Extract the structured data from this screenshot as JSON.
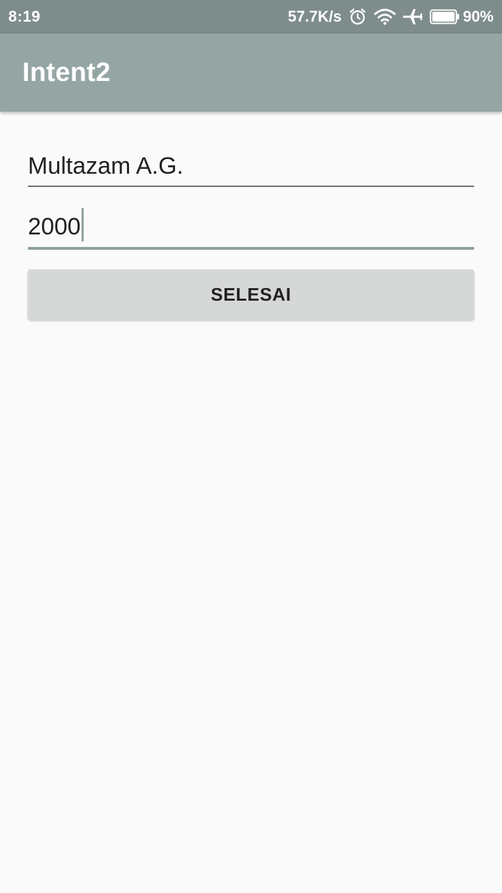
{
  "status_bar": {
    "time": "8:19",
    "network_speed": "57.7K/s",
    "battery_percent": "90%",
    "battery_level": 0.9,
    "icons": [
      "alarm-icon",
      "wifi-icon",
      "airplane-icon",
      "battery-icon"
    ]
  },
  "app_bar": {
    "title": "Intent2"
  },
  "form": {
    "name_value": "Multazam A.G.",
    "number_value": "2000",
    "submit_label": "SELESAI"
  },
  "colors": {
    "status_bar": "#7e8d8c",
    "app_bar": "#95a5a4",
    "accent": "#8fa19f",
    "button": "#d6d7d7",
    "background": "#fafafa"
  }
}
